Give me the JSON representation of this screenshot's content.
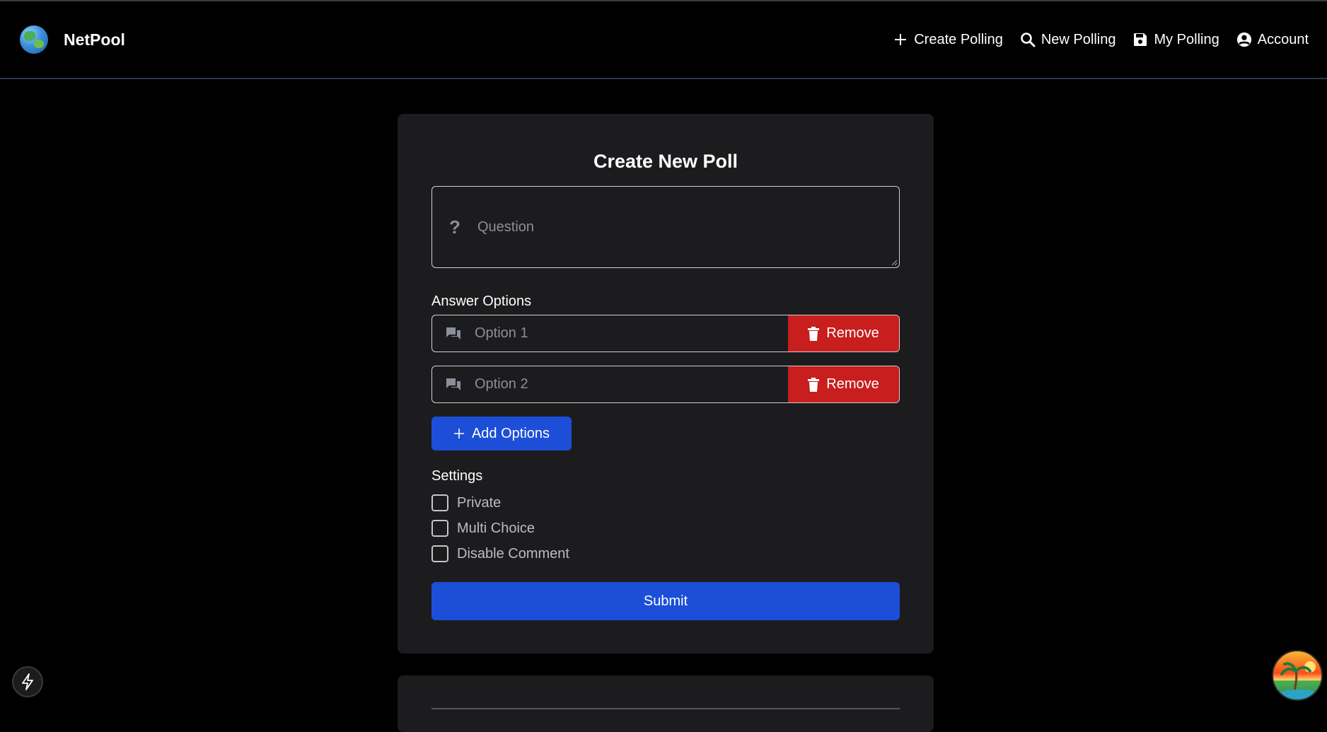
{
  "header": {
    "brand": "NetPool",
    "nav": [
      {
        "label": "Create Polling",
        "icon": "plus-icon"
      },
      {
        "label": "New Polling",
        "icon": "search-icon"
      },
      {
        "label": "My Polling",
        "icon": "save-icon"
      },
      {
        "label": "Account",
        "icon": "user-circle-icon"
      }
    ]
  },
  "form": {
    "title": "Create New Poll",
    "question_placeholder": "Question",
    "answer_options_label": "Answer Options",
    "options": [
      {
        "placeholder": "Option 1",
        "remove_label": "Remove"
      },
      {
        "placeholder": "Option 2",
        "remove_label": "Remove"
      }
    ],
    "add_options_label": "Add Options",
    "settings_label": "Settings",
    "settings": [
      {
        "label": "Private",
        "checked": false
      },
      {
        "label": "Multi Choice",
        "checked": false
      },
      {
        "label": "Disable Comment",
        "checked": false
      }
    ],
    "submit_label": "Submit"
  },
  "colors": {
    "background": "#000000",
    "card": "#1c1c1e",
    "primary": "#1d4ed8",
    "danger": "#c81e1e"
  }
}
